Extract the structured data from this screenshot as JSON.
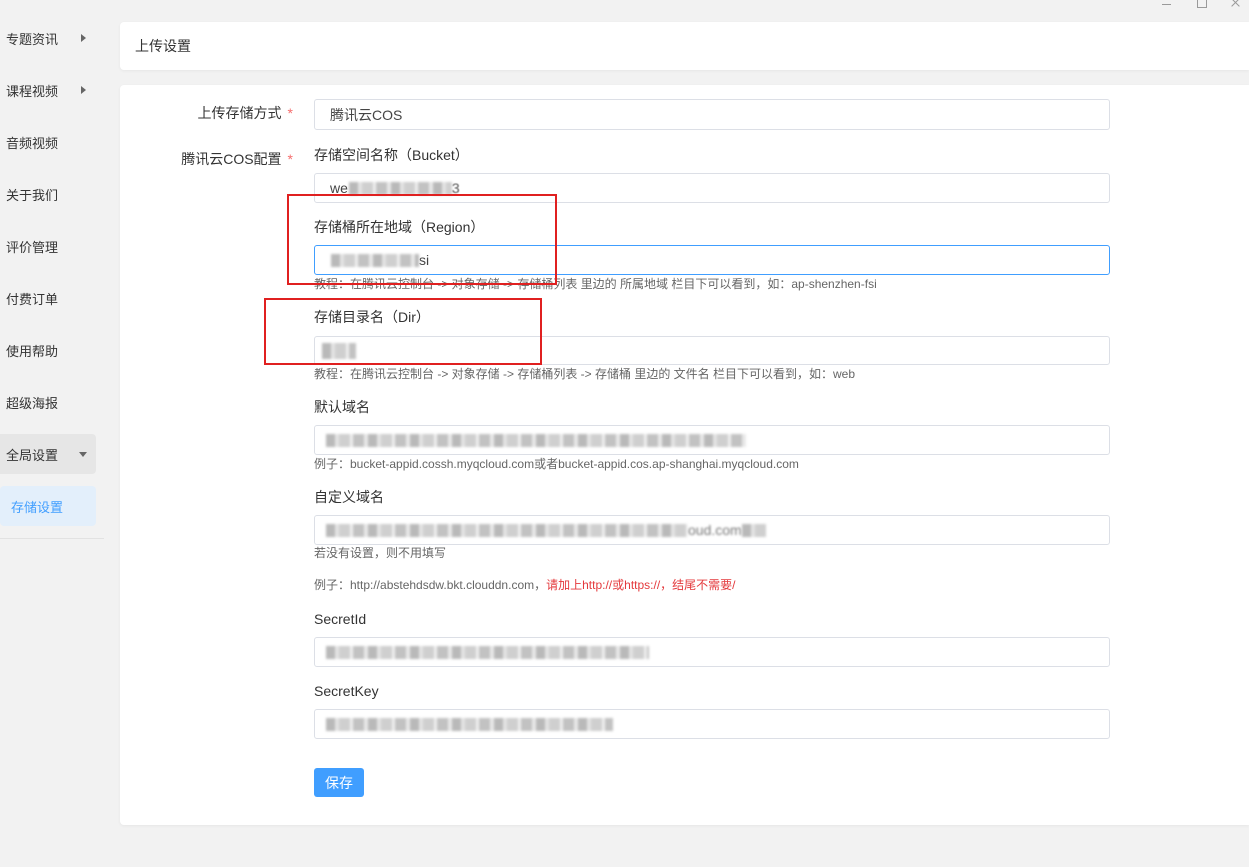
{
  "window_controls": {
    "minimize": {
      "icon": "minimize-icon"
    },
    "maximize": {
      "icon": "maximize-icon"
    },
    "close": {
      "icon": "close-icon"
    }
  },
  "sidebar": {
    "items": [
      {
        "label": "专题资讯",
        "icon": "caret-right-icon"
      },
      {
        "label": "课程视频",
        "icon": "caret-right-icon"
      },
      {
        "label": "音频视频"
      },
      {
        "label": "关于我们"
      },
      {
        "label": "评价管理"
      },
      {
        "label": "付费订单"
      },
      {
        "label": "使用帮助"
      },
      {
        "label": "超级海报"
      },
      {
        "label": "全局设置",
        "icon": "caret-down-icon",
        "expanded": true,
        "children": [
          {
            "label": "存储设置",
            "active": true
          }
        ]
      }
    ]
  },
  "header": {
    "title": "上传设置"
  },
  "form": {
    "storage_method": {
      "label": "上传存储方式",
      "required_mark": "*",
      "value": "腾讯云COS"
    },
    "cos_config": {
      "label": "腾讯云COS配置",
      "required_mark": "*",
      "bucket": {
        "label": "存储空间名称（Bucket）",
        "value_start": "we",
        "value_end": "3"
      },
      "region": {
        "label": "存储桶所在地域（Region）",
        "value_end": "si",
        "focused": true,
        "help": "教程：在腾讯云控制台 -> 对象存储 -> 存储桶列表 里边的 所属地域 栏目下可以看到，如：ap-shenzhen-fsi"
      },
      "dir": {
        "label": "存储目录名（Dir）",
        "help": "教程：在腾讯云控制台 -> 对象存储 -> 存储桶列表 -> 存储桶 里边的 文件名 栏目下可以看到，如：web"
      },
      "default_domain": {
        "label": "默认域名",
        "help": "例子：bucket-appid.cossh.myqcloud.com或者bucket-appid.cos.ap-shanghai.myqcloud.com"
      },
      "custom_domain": {
        "label": "自定义域名",
        "value_end": "oud.com",
        "help": "若没有设置，则不用填写",
        "example": "例子：http://abstehdsdw.bkt.clouddn.com，",
        "example_warning": "请加上http://或https://，结尾不需要/"
      },
      "secret_id": {
        "label": "SecretId"
      },
      "secret_key": {
        "label": "SecretKey"
      }
    },
    "save_label": "保存"
  },
  "colors": {
    "accent": "#409eff",
    "required": "#f56c6c",
    "warning_text": "#e4393c",
    "annotation": "#e02020",
    "active_menu_bg": "#e3effb"
  }
}
